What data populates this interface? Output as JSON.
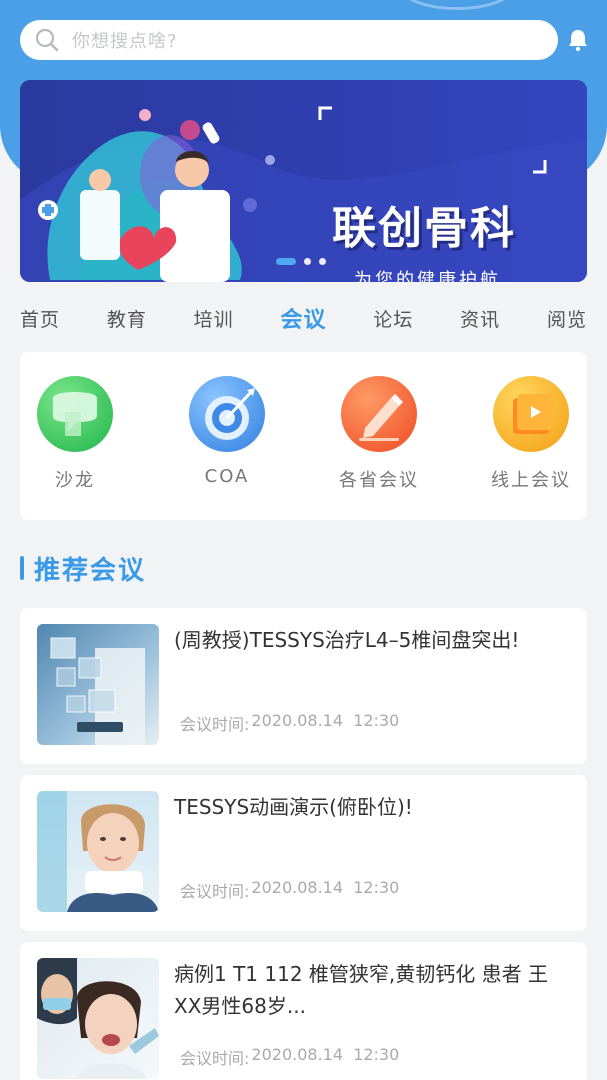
{
  "search": {
    "placeholder": "你想搜点啥?"
  },
  "banner": {
    "title": "联创骨科",
    "subtitle": "为您的健康护航",
    "slide_count": 3,
    "active_slide": 1
  },
  "tabs": [
    {
      "label": "首页",
      "active": false
    },
    {
      "label": "教育",
      "active": false
    },
    {
      "label": "培训",
      "active": false
    },
    {
      "label": "会议",
      "active": true
    },
    {
      "label": "论坛",
      "active": false
    },
    {
      "label": "资讯",
      "active": false
    },
    {
      "label": "阅览",
      "active": false
    }
  ],
  "categories": [
    {
      "label": "沙龙",
      "icon": "salon-icon",
      "color": "#3cc95a"
    },
    {
      "label": "COA",
      "icon": "target-icon",
      "color": "#4a93ea"
    },
    {
      "label": "各省会议",
      "icon": "pencil-icon",
      "color": "#f2622a"
    },
    {
      "label": "线上会议",
      "icon": "video-book-icon",
      "color": "#f6b21c"
    }
  ],
  "section": {
    "title": "推荐会议"
  },
  "meetings": [
    {
      "title": "(周教授)TESSYS治疗L4–5椎间盘突出!",
      "time_label": "会议时间:",
      "time_value": "2020.08.14  12:30",
      "thumb": "doctor-xray-thumb"
    },
    {
      "title": "TESSYS动画演示(俯卧位)!",
      "time_label": "会议时间:",
      "time_value": "2020.08.14  12:30",
      "thumb": "neck-brace-patient-thumb"
    },
    {
      "title": "病例1 T1 112 椎管狭窄,黄韧钙化 患者 王XX男性68岁...",
      "time_label": "会议时间:",
      "time_value": "2020.08.14  12:30",
      "thumb": "dental-patient-thumb"
    }
  ],
  "colors": {
    "primary": "#3a9ae6",
    "header_bg": "#4a9fe6",
    "banner_bg": "#2f3fb0"
  }
}
